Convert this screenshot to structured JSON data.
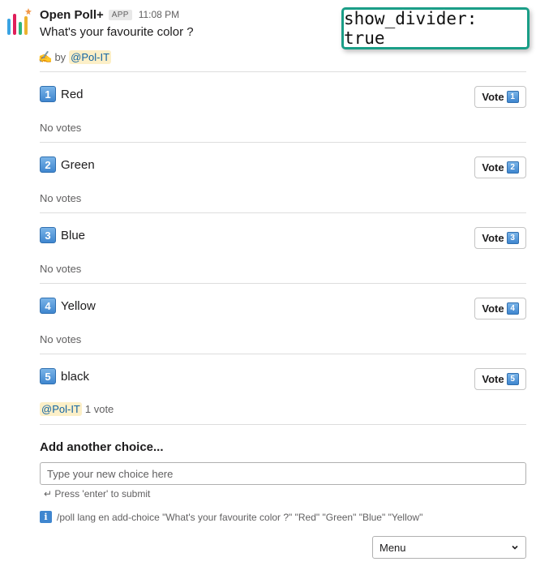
{
  "app": {
    "name": "Open Poll+",
    "badge": "APP",
    "time": "11:08 PM"
  },
  "poll": {
    "question": "What's your favourite color ?",
    "author_prefix": "by",
    "author_mention": "@Pol-IT",
    "choices": [
      {
        "number": "1",
        "label": "Red",
        "vote_label": "Vote",
        "result": "No votes"
      },
      {
        "number": "2",
        "label": "Green",
        "vote_label": "Vote",
        "result": "No votes"
      },
      {
        "number": "3",
        "label": "Blue",
        "vote_label": "Vote",
        "result": "No votes"
      },
      {
        "number": "4",
        "label": "Yellow",
        "vote_label": "Vote",
        "result": "No votes"
      },
      {
        "number": "5",
        "label": "black",
        "vote_label": "Vote",
        "voter": "@Pol-IT",
        "count": "1 vote"
      }
    ]
  },
  "add_choice": {
    "title": "Add another choice...",
    "placeholder": "Type your new choice here",
    "hint": "↵ Press 'enter' to submit"
  },
  "command_info": {
    "icon": "i",
    "text": "/poll lang en add-choice \"What's your favourite color ?\" \"Red\" \"Green\" \"Blue\" \"Yellow\""
  },
  "menu": {
    "label": "Menu"
  },
  "overlay": {
    "text": "show_divider: true"
  },
  "colors": {
    "mention_bg": "#fcefc7",
    "keycap_blue": "#3f86cf",
    "overlay_border": "#1a9e87"
  }
}
